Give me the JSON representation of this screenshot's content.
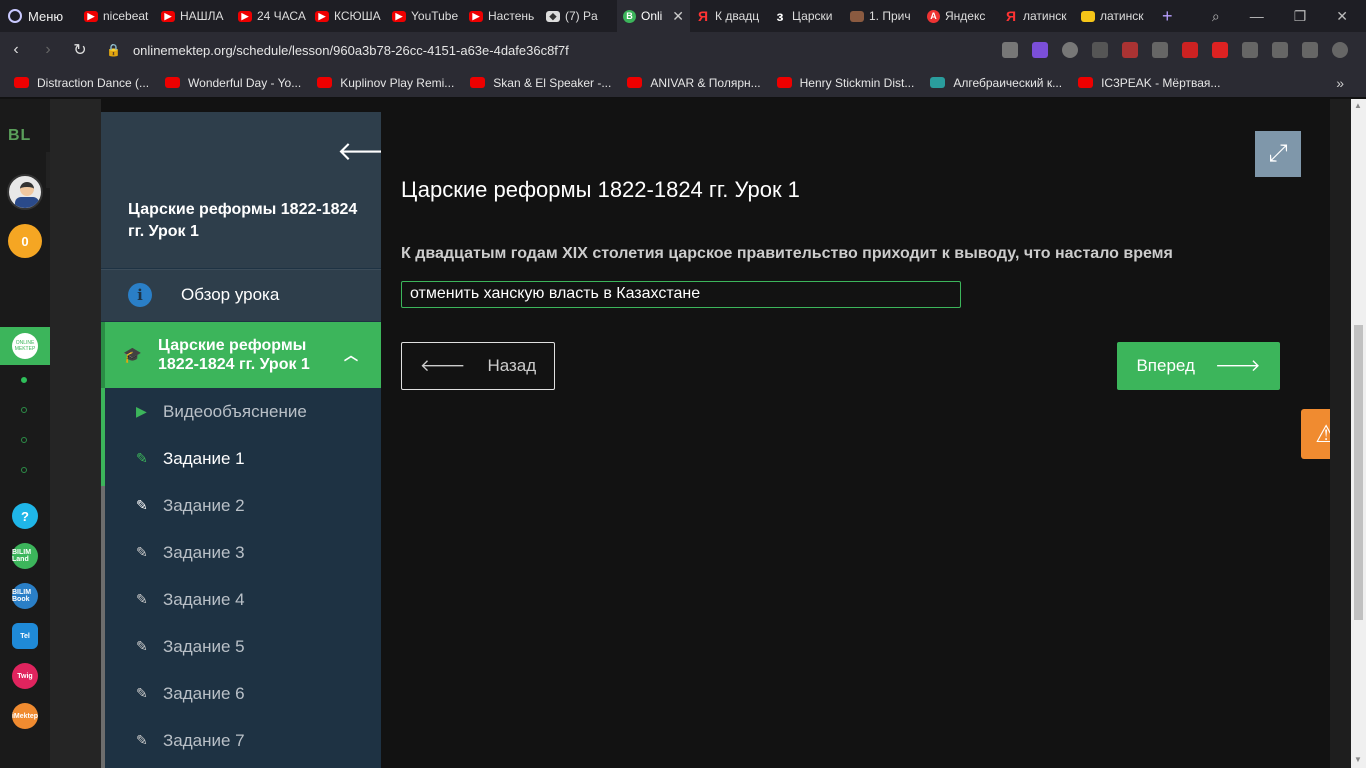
{
  "browser": {
    "menu_label": "Меню",
    "tabs": [
      {
        "label": "nicebeat",
        "icon": "youtube-icon"
      },
      {
        "label": "НАШЛА",
        "icon": "youtube-icon"
      },
      {
        "label": "24 ЧАСА",
        "icon": "youtube-icon"
      },
      {
        "label": "КСЮША",
        "icon": "youtube-icon"
      },
      {
        "label": "YouTube",
        "icon": "youtube-icon"
      },
      {
        "label": "Настень",
        "icon": "youtube-icon"
      },
      {
        "label": "(7) Pa",
        "icon": "roblox-icon"
      },
      {
        "label": "Onli",
        "icon": "onlinemektep-icon",
        "active": true
      },
      {
        "label": "К двадц",
        "icon": "yandex-icon"
      },
      {
        "label": "Царски",
        "icon": "z-icon"
      },
      {
        "label": "1. Прич",
        "icon": "book-icon"
      },
      {
        "label": "Яндекс",
        "icon": "yandex-icon"
      },
      {
        "label": "латинск",
        "icon": "yandex-icon"
      },
      {
        "label": "латинск",
        "icon": "image-icon"
      }
    ],
    "url": "onlinemektep.org/schedule/lesson/960a3b78-26cc-4151-a63e-4dafe36c8f7f",
    "bookmarks": [
      {
        "label": "Distraction Dance (...",
        "icon": "youtube-icon"
      },
      {
        "label": "Wonderful Day - Yo...",
        "icon": "youtube-icon"
      },
      {
        "label": "Kuplinov Play Remi...",
        "icon": "youtube-icon"
      },
      {
        "label": "Skan & El Speaker -...",
        "icon": "youtube-icon"
      },
      {
        "label": "ANIVAR & Полярн...",
        "icon": "youtube-icon"
      },
      {
        "label": "Henry Stickmin Dist...",
        "icon": "youtube-icon"
      },
      {
        "label": "Алгебраический к...",
        "icon": "vk-icon"
      },
      {
        "label": "IC3PEAK - Мёртвая...",
        "icon": "youtube-icon"
      }
    ]
  },
  "rail": {
    "logo": "BL",
    "coins": "0",
    "active_app": "ONLINE MEKTEP",
    "apps": [
      {
        "name": "help",
        "label": "?",
        "color": "#1fb6e8"
      },
      {
        "name": "bilimland",
        "label": "BILIM Land",
        "color": "#3cb55b"
      },
      {
        "name": "bilimbook",
        "label": "BILIM Book",
        "color": "#2a7fc7"
      },
      {
        "name": "calendar",
        "label": "Tel",
        "color": "#1f8ad8"
      },
      {
        "name": "twig",
        "label": "Twig",
        "color": "#e0245e"
      },
      {
        "name": "imektep",
        "label": "iMektep",
        "color": "#f08b30"
      }
    ]
  },
  "sidebar": {
    "title": "Царские реформы 1822-1824 гг. Урок 1",
    "overview_label": "Обзор урока",
    "lesson_label": "Царские реформы 1822-1824 гг. Урок 1",
    "items": [
      {
        "label": "Видеообъяснение",
        "state": "done"
      },
      {
        "label": "Задание 1",
        "state": "current"
      },
      {
        "label": "Задание 2",
        "state": "todo"
      },
      {
        "label": "Задание 3",
        "state": "todo"
      },
      {
        "label": "Задание 4",
        "state": "todo"
      },
      {
        "label": "Задание 5",
        "state": "todo"
      },
      {
        "label": "Задание 6",
        "state": "todo"
      },
      {
        "label": "Задание 7",
        "state": "todo"
      }
    ]
  },
  "main": {
    "title": "Царские реформы 1822-1824 гг. Урок 1",
    "question": "К двадцатым годам XIX столетия царское правительство приходит к выводу, что настало время",
    "answer": "отменить ханскую власть в Казахстане",
    "back_label": "Назад",
    "next_label": "Вперед"
  },
  "colors": {
    "accent": "#3cb55b",
    "sidebar_bg": "#1e3243",
    "warning": "#f08b30"
  }
}
